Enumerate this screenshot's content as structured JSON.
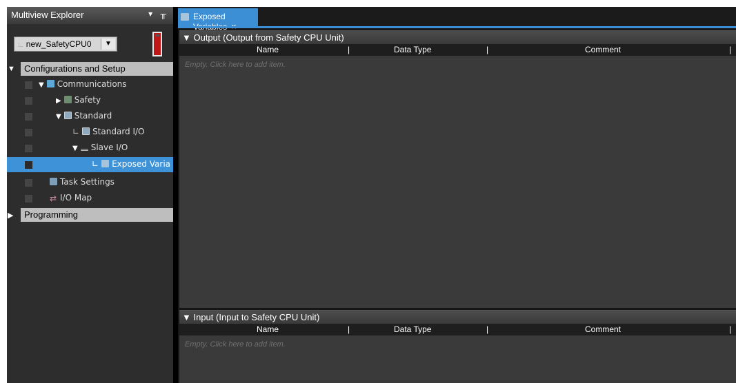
{
  "explorer": {
    "title": "Multiview Explorer",
    "header_icons": "▾ ╥",
    "device": {
      "prefix": "∟",
      "value": "new_SafetyCPU0",
      "arrow": "▼"
    },
    "sections": [
      {
        "arrow": "▼",
        "label": "Configurations and Setup"
      },
      {
        "arrow": "▶",
        "label": "Programming"
      }
    ],
    "tree": [
      {
        "tri": "▼",
        "label": "Communications"
      },
      {
        "tri": "▶",
        "label": "Safety"
      },
      {
        "tri": "▼",
        "label": "Standard"
      },
      {
        "con": "∟",
        "label": "Standard I/O"
      },
      {
        "tri": "▼",
        "label": "Slave I/O"
      },
      {
        "con": "∟",
        "label": "Exposed Varia"
      },
      {
        "label": "Task Settings"
      },
      {
        "label": "I/O Map"
      }
    ]
  },
  "tab": {
    "label": "Exposed Variables",
    "close": "×"
  },
  "output": {
    "title": "▼ Output (Output from Safety CPU Unit)",
    "columns": [
      "Name",
      "Data Type",
      "Comment"
    ],
    "separator": "|",
    "empty_hint": "Empty. Click here to add item."
  },
  "input": {
    "title": "▼ Input (Input to Safety CPU Unit)",
    "columns": [
      "Name",
      "Data Type",
      "Comment"
    ],
    "separator": "|",
    "empty_hint": "Empty. Click here to add item."
  },
  "colors": {
    "selection": "#3e92d8",
    "tab_active": "#3c8fd4",
    "section_bar": "#bebebe",
    "cpu_status": "#c01818"
  }
}
